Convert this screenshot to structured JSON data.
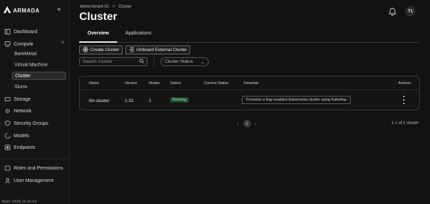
{
  "sidebar": {
    "logo": "ARMADA",
    "items": {
      "dashboard": "Dashboard",
      "compute": "Compute",
      "baremetal": "BareMetal",
      "vm": "Virtual Machine",
      "cluster": "Cluster",
      "slurm": "Slurm",
      "storage": "Storage",
      "network": "Network",
      "security": "Security Groups",
      "models": "Models",
      "endpoints": "Endpoints",
      "roles": "Roles and Permissions",
      "users": "User Management"
    },
    "build": "Build: v2025.12.16-rc3"
  },
  "header": {
    "breadcrumb_tenant": "demo-tenant-01",
    "breadcrumb_sep": ">",
    "breadcrumb_page": "Cluster",
    "title": "Cluster",
    "avatar": "T1"
  },
  "tabs": {
    "overview": "Overview",
    "applications": "Applications"
  },
  "toolbar": {
    "create": "Create Cluster",
    "onboard": "Onboard External Cluster",
    "search_placeholder": "Search Cluster",
    "status_select": "Cluster Status"
  },
  "table": {
    "headers": {
      "name": "Name",
      "version": "Version",
      "nodes": "Nodes",
      "status": "Status",
      "current_status": "Current Status",
      "template": "Template",
      "actions": "Actions"
    },
    "rows": [
      {
        "name": "llm-cluster",
        "version": "1.31",
        "nodes": "1",
        "status": "Running",
        "current_status": "",
        "template": "Provision a Ray-enabled Kubernetes cluster using KubeRay"
      }
    ]
  },
  "pagination": {
    "page": "1",
    "info": "1-1 of 1 shown"
  },
  "colors": {
    "running_badge": "#1c4a2c",
    "background": "#121212"
  }
}
